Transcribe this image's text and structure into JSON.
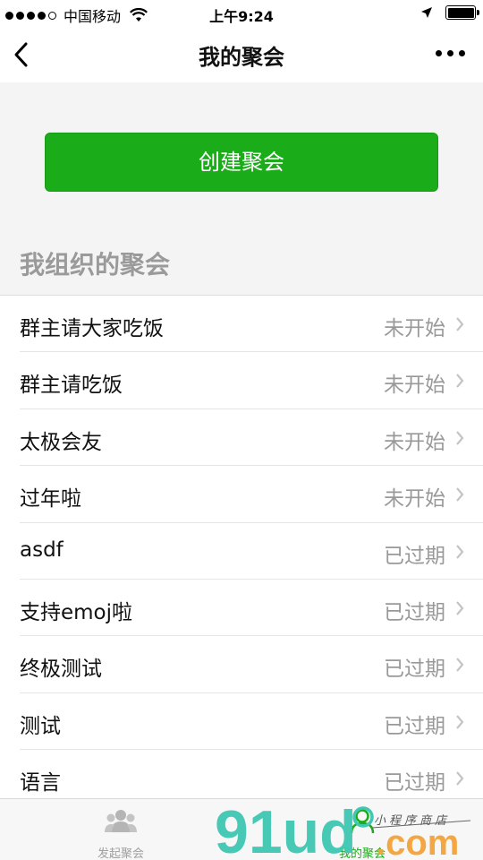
{
  "status_bar": {
    "carrier": "中国移动",
    "time": "上午9:24"
  },
  "nav": {
    "title": "我的聚会"
  },
  "create_button_label": "创建聚会",
  "section_title": "我组织的聚会",
  "parties": [
    {
      "name": "群主请大家吃饭",
      "status": "未开始"
    },
    {
      "name": "群主请吃饭",
      "status": "未开始"
    },
    {
      "name": "太极会友",
      "status": "未开始"
    },
    {
      "name": "过年啦",
      "status": "未开始"
    },
    {
      "name": "asdf",
      "status": "已过期"
    },
    {
      "name": "支持emoj啦",
      "status": "已过期"
    },
    {
      "name": "终极测试",
      "status": "已过期"
    },
    {
      "name": "测试",
      "status": "已过期"
    },
    {
      "name": "语言",
      "status": "已过期"
    }
  ],
  "tabs": [
    {
      "label": "发起聚会",
      "icon": "group-icon",
      "active": false
    },
    {
      "label": "我的聚会",
      "icon": "my-party-icon",
      "active": true
    }
  ],
  "watermark": {
    "text": "91ud.com",
    "tagline": "小程序商店"
  },
  "colors": {
    "accent": "#1aad19",
    "status_gray": "#999999",
    "section_title_gray": "#9a9a9a",
    "watermark_teal": "#3fc7b3",
    "watermark_orange": "#f2a33a"
  }
}
